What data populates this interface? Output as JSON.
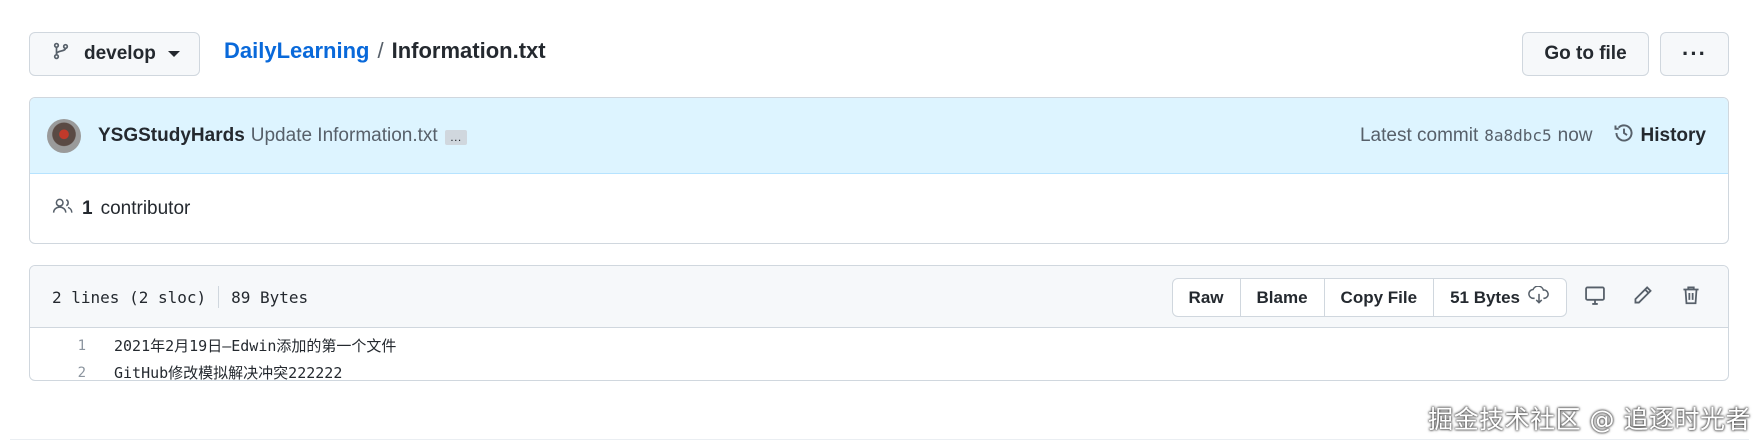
{
  "header": {
    "branch": "develop",
    "repo": "DailyLearning",
    "separator": "/",
    "file": "Information.txt",
    "goto_file": "Go to file",
    "more": "···"
  },
  "commit": {
    "author": "YSGStudyHards",
    "message": "Update Information.txt",
    "ellipsis": "…",
    "latest_label": "Latest commit",
    "sha": "8a8dbc5",
    "time": "now",
    "history": "History"
  },
  "contributors": {
    "count": "1",
    "label": "contributor"
  },
  "file": {
    "lines": "2 lines (2 sloc)",
    "size": "89 Bytes",
    "raw": "Raw",
    "blame": "Blame",
    "copy": "Copy File",
    "download_size": "51 Bytes",
    "code": [
      {
        "num": "1",
        "text": "2021年2月19日—Edwin添加的第一个文件"
      },
      {
        "num": "2",
        "text": "GitHub修改模拟解决冲突222222"
      }
    ]
  },
  "watermark": "掘金技术社区 @ 追逐时光者",
  "colors": {
    "link": "#0969da",
    "commit_bg": "#ddf4ff",
    "border": "#d0d7de",
    "header_bg": "#f6f8fa"
  }
}
